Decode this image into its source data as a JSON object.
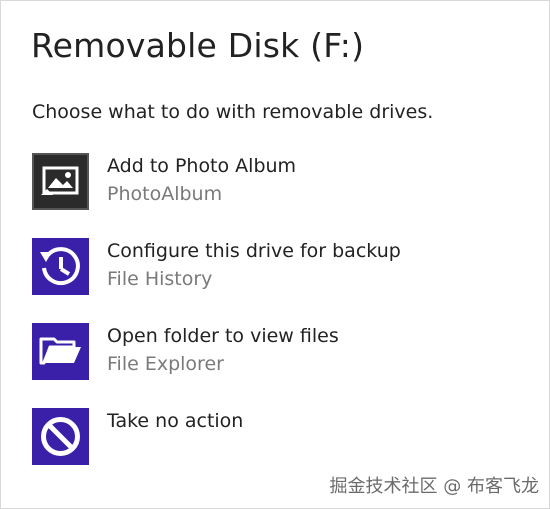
{
  "dialog": {
    "title": "Removable Disk (F:)",
    "prompt": "Choose what to do with removable drives."
  },
  "options": [
    {
      "label": "Add to Photo Album",
      "sublabel": "PhotoAlbum",
      "icon": "photo-album-icon",
      "tile_color": "#2b2b2b"
    },
    {
      "label": "Configure this drive for backup",
      "sublabel": "File History",
      "icon": "history-clock-icon",
      "tile_color": "#3a1fa8"
    },
    {
      "label": "Open folder to view files",
      "sublabel": "File Explorer",
      "icon": "folder-open-icon",
      "tile_color": "#3a1fa8"
    },
    {
      "label": "Take no action",
      "sublabel": "",
      "icon": "no-action-icon",
      "tile_color": "#3a1fa8"
    }
  ],
  "watermark": "掘金技术社区 @ 布客飞龙"
}
